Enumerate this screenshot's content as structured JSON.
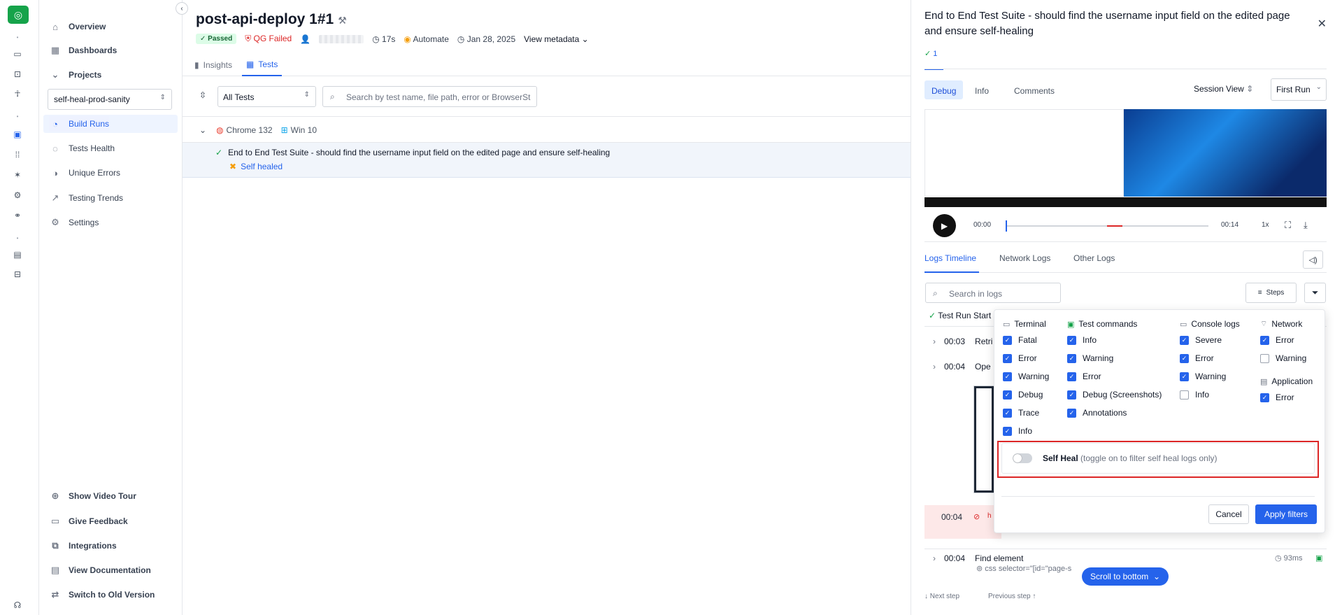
{
  "sidebar": {
    "items": [
      {
        "label": "Overview",
        "icon": "home-icon"
      },
      {
        "label": "Dashboards",
        "icon": "grid-icon"
      },
      {
        "label": "Projects",
        "icon": "chevron-down-icon"
      },
      {
        "label": "Build Runs",
        "icon": "build-runs-icon"
      },
      {
        "label": "Tests Health",
        "icon": "tests-health-icon"
      },
      {
        "label": "Unique Errors",
        "icon": "unique-errors-icon"
      },
      {
        "label": "Testing Trends",
        "icon": "trends-icon"
      },
      {
        "label": "Settings",
        "icon": "gear-icon"
      }
    ],
    "project_select": "self-heal-prod-sanity",
    "footer": [
      {
        "label": "Show Video Tour",
        "icon": "video-icon"
      },
      {
        "label": "Give Feedback",
        "icon": "feedback-icon"
      },
      {
        "label": "Integrations",
        "icon": "integrations-icon"
      },
      {
        "label": "View Documentation",
        "icon": "doc-icon"
      },
      {
        "label": "Switch to Old Version",
        "icon": "switch-icon"
      }
    ]
  },
  "header": {
    "title": "post-api-deploy 1#1",
    "status": "Passed",
    "qg": "QG Failed",
    "duration": "17s",
    "source": "Automate",
    "date": "Jan 28, 2025",
    "view_metadata": "View metadata"
  },
  "tabs": [
    {
      "label": "Insights"
    },
    {
      "label": "Tests"
    }
  ],
  "filters": {
    "tests_select": "All Tests",
    "search_placeholder": "Search by test name, file path, error or BrowserSt"
  },
  "group": {
    "browser": "Chrome 132",
    "os": "Win 10"
  },
  "test": {
    "name": "End to End Test Suite - should find the username input field on the edited page and ensure self-healing",
    "tag": "Self healed"
  },
  "panel": {
    "title": "End to End Test Suite - should find the username input field on the edited page and ensure self-healing",
    "run_number": "1",
    "tabs": [
      "Debug",
      "Info",
      "Comments"
    ],
    "session_view": "Session View",
    "run_select": "First Run",
    "time_start": "00:00",
    "time_end": "00:14",
    "speed": "1x",
    "log_tabs": [
      "Logs Timeline",
      "Network Logs",
      "Other Logs"
    ],
    "search_logs_placeholder": "Search in logs",
    "steps_label": "Steps",
    "test_run_start": "Test Run Start",
    "logs": [
      {
        "time": "00:03",
        "text": "Retri"
      },
      {
        "time": "00:04",
        "text": "Ope"
      },
      {
        "time": "00:04",
        "text": "h"
      },
      {
        "time": "00:04",
        "text": "Find element",
        "duration": "93ms",
        "sub": "css selector=\"[id=\"page-s"
      }
    ],
    "scroll_bottom": "Scroll to bottom",
    "next_step": "Next step",
    "previous_step": "Previous step"
  },
  "log_filters": {
    "columns": [
      {
        "title": "Terminal",
        "items": [
          {
            "label": "Fatal",
            "checked": true
          },
          {
            "label": "Error",
            "checked": true
          },
          {
            "label": "Warning",
            "checked": true
          },
          {
            "label": "Debug",
            "checked": true
          },
          {
            "label": "Trace",
            "checked": true
          },
          {
            "label": "Info",
            "checked": true
          }
        ]
      },
      {
        "title": "Test commands",
        "items": [
          {
            "label": "Info",
            "checked": true
          },
          {
            "label": "Warning",
            "checked": true
          },
          {
            "label": "Error",
            "checked": true
          },
          {
            "label": "Debug (Screenshots)",
            "checked": true
          },
          {
            "label": "Annotations",
            "checked": true
          }
        ]
      },
      {
        "title": "Console logs",
        "items": [
          {
            "label": "Severe",
            "checked": true
          },
          {
            "label": "Error",
            "checked": true
          },
          {
            "label": "Warning",
            "checked": true
          },
          {
            "label": "Info",
            "checked": false
          }
        ]
      },
      {
        "title": "Network",
        "items": [
          {
            "label": "Error",
            "checked": true
          },
          {
            "label": "Warning",
            "checked": false
          }
        ]
      },
      {
        "title": "Application",
        "items": [
          {
            "label": "Error",
            "checked": true
          }
        ]
      }
    ],
    "self_heal_label": "Self Heal",
    "self_heal_hint": "(toggle on to filter self heal logs only)",
    "self_heal_on": false,
    "cancel": "Cancel",
    "apply": "Apply filters"
  }
}
